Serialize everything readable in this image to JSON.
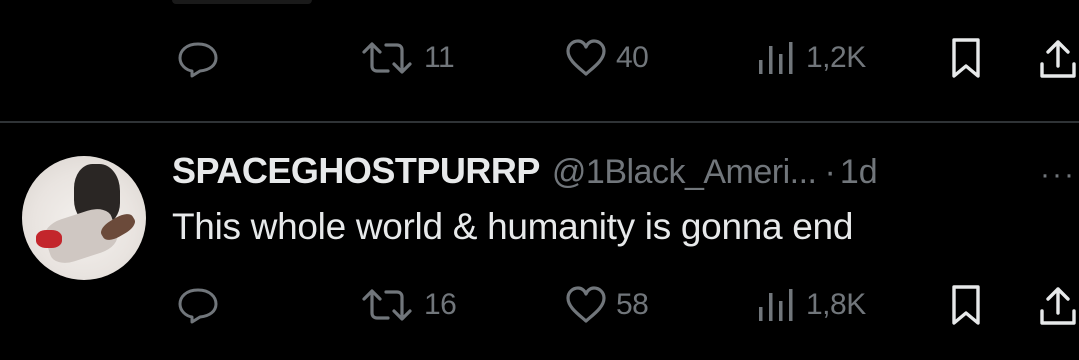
{
  "top_actions": {
    "retweets": "11",
    "likes": "40",
    "views": "1,2K"
  },
  "reply": {
    "display_name": "SPACEGHOSTPURRP",
    "handle": "@1Black_Ameri...",
    "separator": "·",
    "time": "1d",
    "text": "This whole world & humanity is gonna end",
    "actions": {
      "retweets": "16",
      "likes": "58",
      "views": "1,8K"
    }
  },
  "icons": {
    "reply": "speech-bubble",
    "retweet": "retweet-arrows",
    "like": "heart",
    "views": "bar-chart",
    "bookmark": "bookmark",
    "share": "share-upload",
    "more": "ellipsis"
  },
  "colors": {
    "background": "#000000",
    "text_primary": "#e7e9ea",
    "text_secondary": "#71767b",
    "divider": "#2f3336"
  }
}
